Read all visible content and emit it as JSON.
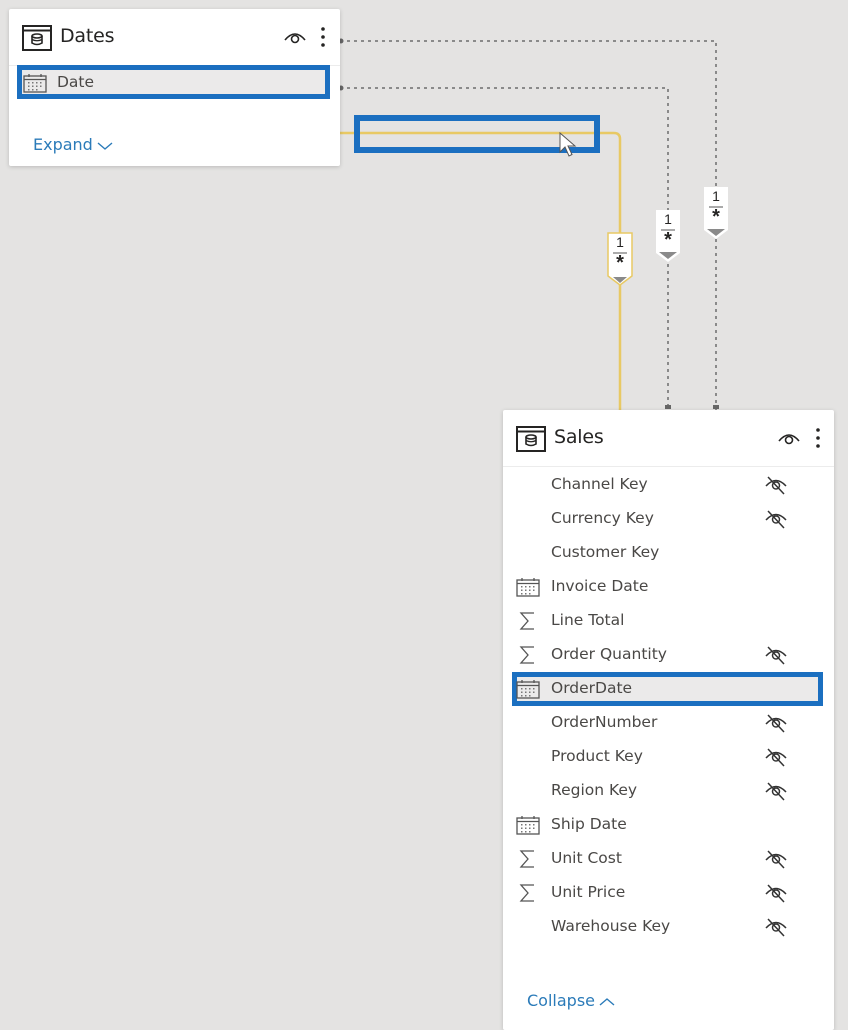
{
  "colors": {
    "canvas_bg": "#e4e3e2",
    "card_bg": "#ffffff",
    "highlight_blue": "#1b6fc0",
    "active_relationship": "#e8c964",
    "inactive_relationship": "#8a8a8a",
    "link_blue": "#2b7bb9"
  },
  "dates_table": {
    "title": "Dates",
    "icon": "table-icon",
    "visibility_icon": "eye-icon",
    "menu_icon": "more-vertical-icon",
    "fields": [
      {
        "name": "Date",
        "icon": "calendar-icon",
        "hidden": false,
        "highlighted": true
      }
    ],
    "toggle_label": "Expand",
    "toggle_icon": "chevron-down-icon"
  },
  "sales_table": {
    "title": "Sales",
    "icon": "table-icon",
    "visibility_icon": "eye-icon",
    "menu_icon": "more-vertical-icon",
    "fields": [
      {
        "name": "Channel Key",
        "icon": "",
        "hidden": true
      },
      {
        "name": "Currency Key",
        "icon": "",
        "hidden": true
      },
      {
        "name": "Customer Key",
        "icon": "",
        "hidden": false
      },
      {
        "name": "Invoice Date",
        "icon": "calendar-icon",
        "hidden": false
      },
      {
        "name": "Line Total",
        "icon": "sigma-icon",
        "hidden": false
      },
      {
        "name": "Order Quantity",
        "icon": "sigma-icon",
        "hidden": true
      },
      {
        "name": "OrderDate",
        "icon": "calendar-icon",
        "hidden": false,
        "highlighted": true
      },
      {
        "name": "OrderNumber",
        "icon": "",
        "hidden": true
      },
      {
        "name": "Product Key",
        "icon": "",
        "hidden": true
      },
      {
        "name": "Region Key",
        "icon": "",
        "hidden": true
      },
      {
        "name": "Ship Date",
        "icon": "calendar-icon",
        "hidden": false
      },
      {
        "name": "Unit Cost",
        "icon": "sigma-icon",
        "hidden": true
      },
      {
        "name": "Unit Price",
        "icon": "sigma-icon",
        "hidden": true
      },
      {
        "name": "Warehouse Key",
        "icon": "",
        "hidden": true
      }
    ],
    "toggle_label": "Collapse",
    "toggle_icon": "chevron-up-icon"
  },
  "relationships": [
    {
      "from": "Dates",
      "to": "Sales",
      "cardinality_one": "1",
      "cardinality_many": "*",
      "active": true,
      "selected": true
    },
    {
      "from": "Dates",
      "to": "Sales",
      "cardinality_one": "1",
      "cardinality_many": "*",
      "active": false
    },
    {
      "from": "Dates",
      "to": "Sales",
      "cardinality_one": "1",
      "cardinality_many": "*",
      "active": false
    }
  ]
}
